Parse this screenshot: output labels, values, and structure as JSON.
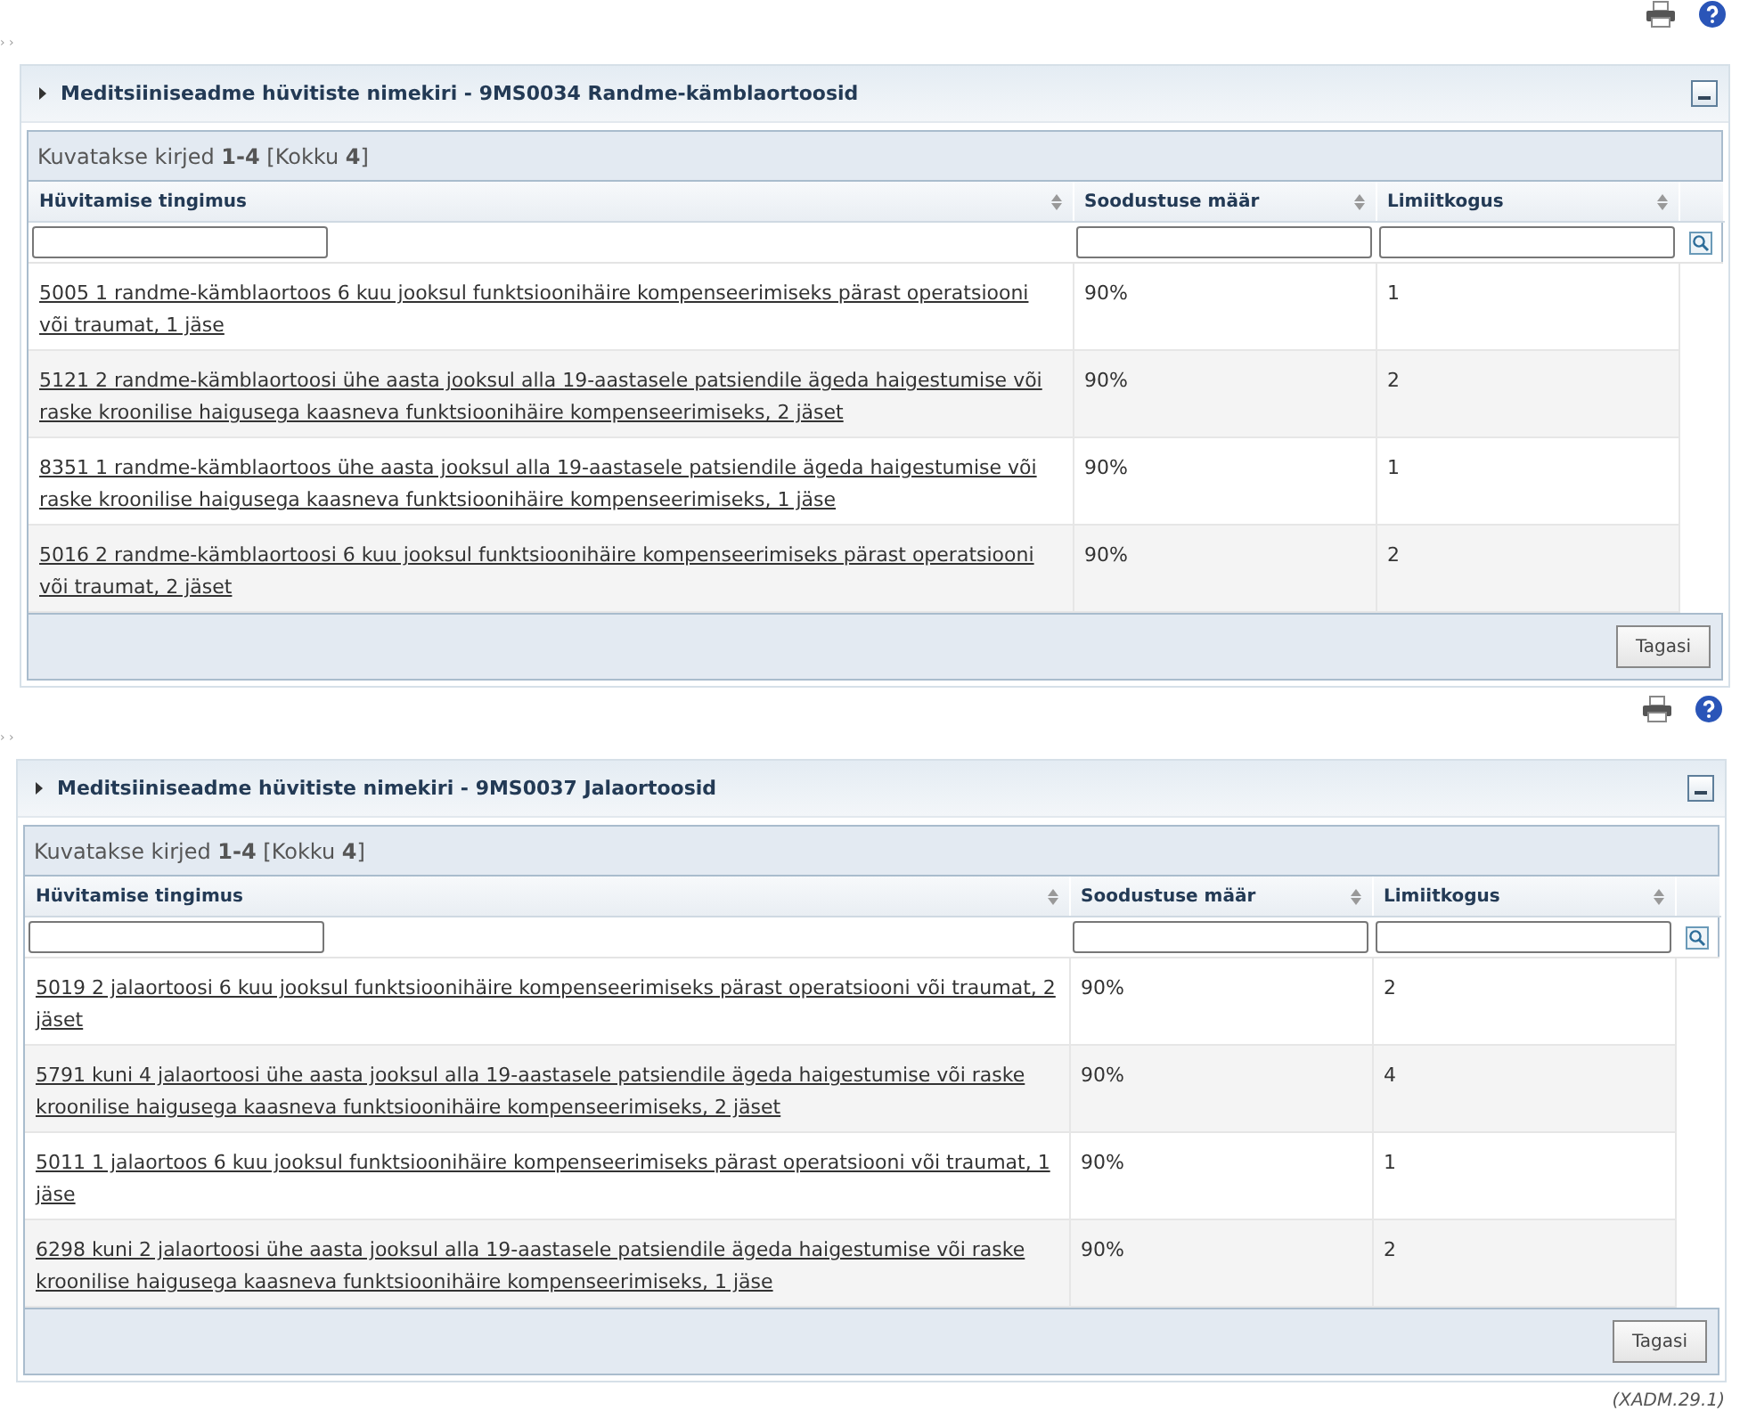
{
  "sections": [
    {
      "breadcrumb": "› ›",
      "panel": {
        "title": "Meditsiiniseadme hüvitiste nimekiri - 9MS0034 Randme-kämblaortoosid",
        "expanded": true,
        "info": "Kuvatakse kirjed **1-4** [Kokku **4**]",
        "columns": [
          "Hüvitamise tingimus",
          "Soodustuse määr",
          "Limiitkogus"
        ],
        "rows": [
          {
            "condition": "5005 1 randme-kämblaortoos 6 kuu jooksul funktsioonihäire kompenseerimiseks pärast operatsiooni või traumat, 1 jäse",
            "rate": "90%",
            "limit": "1"
          },
          {
            "condition": "5121 2 randme-kämblaortoosi ühe aasta jooksul alla 19-aastasele patsiendile ägeda haigestumise või raske kroonilise haigusega kaasneva funktsioonihäire kompenseerimiseks, 2 jäset",
            "rate": "90%",
            "limit": "2"
          },
          {
            "condition": "8351 1 randme-kämblaortoos ühe aasta jooksul alla 19-aastasele patsiendile ägeda haigestumise või raske kroonilise haigusega kaasneva funktsioonihäire kompenseerimiseks, 1 jäse",
            "rate": "90%",
            "limit": "1"
          },
          {
            "condition": "5016 2 randme-kämblaortoosi 6 kuu jooksul funktsioonihäire kompenseerimiseks pärast operatsiooni või traumat, 2 jäset",
            "rate": "90%",
            "limit": "2"
          }
        ],
        "button": "Tagasi"
      }
    },
    {
      "breadcrumb": "› ›",
      "panel": {
        "title": "Meditsiiniseadme hüvitiste nimekiri - 9MS0037 Jalaortoosid",
        "expanded": true,
        "info": "Kuvatakse kirjed **1-4** [Kokku **4**]",
        "columns": [
          "Hüvitamise tingimus",
          "Soodustuse määr",
          "Limiitkogus"
        ],
        "rows": [
          {
            "condition": "5019 2 jalaortoosi 6 kuu jooksul funktsioonihäire kompenseerimiseks pärast operatsiooni või traumat, 2 jäset",
            "rate": "90%",
            "limit": "2"
          },
          {
            "condition": "5791 kuni 4 jalaortoosi ühe aasta jooksul alla 19-aastasele patsiendile ägeda haigestumise või raske kroonilise haigusega kaasneva funktsioonihäire kompenseerimiseks, 2 jäset",
            "rate": "90%",
            "limit": "4"
          },
          {
            "condition": "5011 1 jalaortoos 6 kuu jooksul funktsioonihäire kompenseerimiseks pärast operatsiooni või traumat, 1 jäse",
            "rate": "90%",
            "limit": "1"
          },
          {
            "condition": "6298 kuni 2 jalaortoosi ühe aasta jooksul alla 19-aastasele patsiendile ägeda haigestumise või raske kroonilise haigusega kaasneva funktsioonihäire kompenseerimiseks, 1 jäse",
            "rate": "90%",
            "limit": "2"
          }
        ],
        "button": "Tagasi"
      }
    }
  ],
  "footer": "(XADM.29.1)"
}
